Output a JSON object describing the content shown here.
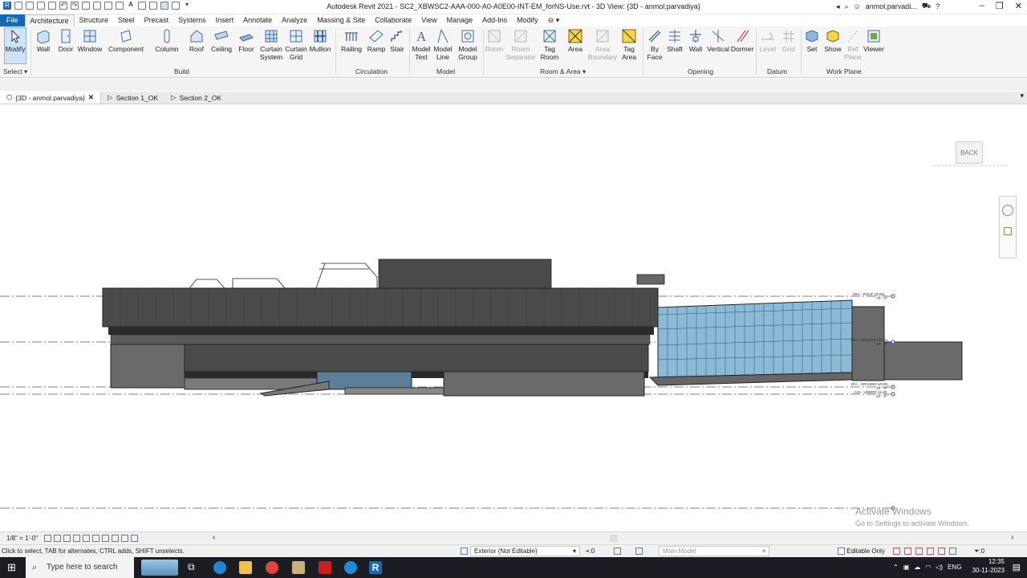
{
  "window": {
    "title": "Autodesk Revit 2021 - SC2_XBWSC2-AAA-000-A0-A0E00-INT-EM_forNS-Use.rvt - 3D View: {3D - anmol.parvadiya}",
    "user": "anmol.parvadi..."
  },
  "ribbon_tabs": [
    "File",
    "Architecture",
    "Structure",
    "Steel",
    "Precast",
    "Systems",
    "Insert",
    "Annotate",
    "Analyze",
    "Massing & Site",
    "Collaborate",
    "View",
    "Manage",
    "Add-Ins",
    "Modify"
  ],
  "ribbon": {
    "modify": "Modify",
    "select": "Select",
    "build": {
      "label": "Build",
      "wall": "Wall",
      "door": "Door",
      "window": "Window",
      "component": "Component",
      "column": "Column",
      "roof": "Roof",
      "ceiling": "Ceiling",
      "floor": "Floor",
      "curtain_system_1": "Curtain",
      "curtain_system_2": "System",
      "curtain_grid_1": "Curtain",
      "curtain_grid_2": "Grid",
      "mullion": "Mullion"
    },
    "circulation": {
      "label": "Circulation",
      "railing": "Railing",
      "ramp": "Ramp",
      "stair": "Stair"
    },
    "model": {
      "label": "Model",
      "model_text_1": "Model",
      "model_text_2": "Text",
      "model_line_1": "Model",
      "model_line_2": "Line",
      "model_group_1": "Model",
      "model_group_2": "Group"
    },
    "room_area": {
      "label": "Room & Area",
      "room": "Room",
      "room_sep_1": "Room",
      "room_sep_2": "Separator",
      "tag_room_1": "Tag",
      "tag_room_2": "Room",
      "area": "Area",
      "area_boundary_1": "Area",
      "area_boundary_2": "Boundary",
      "tag_area_1": "Tag",
      "tag_area_2": "Area"
    },
    "opening": {
      "label": "Opening",
      "by_face_1": "By",
      "by_face_2": "Face",
      "shaft": "Shaft",
      "wall": "Wall",
      "vertical": "Vertical",
      "dormer": "Dormer"
    },
    "datum": {
      "label": "Datum",
      "level": "Level",
      "grid": "Grid"
    },
    "work_plane": {
      "label": "Work Plane",
      "set": "Set",
      "show": "Show",
      "ref_plane_1": "Ref",
      "ref_plane_2": "Plane",
      "viewer": "Viewer"
    }
  },
  "view_tabs": [
    {
      "label": "{3D - anmol.parvadiya}"
    },
    {
      "label": "Section 1_OK"
    },
    {
      "label": "Section 2_OK"
    }
  ],
  "levels": [
    {
      "name": "3RA - ROOF LEVEL",
      "elev": "70' - 0\""
    },
    {
      "name": "2RA - SECOND LEVEL",
      "elev": "60' - 0\""
    },
    {
      "name": "1RA - GROUND LEVEL",
      "elev": "45' - 0\""
    },
    {
      "name": "1UA - UNDER SLAB",
      "elev": "42' - 6\""
    }
  ],
  "viewcube": {
    "label": "BACK"
  },
  "view_control": {
    "scale": "1/8\" = 1'-0\""
  },
  "status": {
    "hint": "Click to select, TAB for alternates, CTRL adds, SHIFT unselects.",
    "workset": "Exterior (Not Editable)",
    "selection_count": ":0",
    "design_option": "Main Model",
    "editable_only": "Editable Only",
    "filter_count": ":0"
  },
  "watermark": {
    "title": "Activate Windows",
    "subtitle": "Go to Settings to activate Windows."
  },
  "taskbar": {
    "search_placeholder": "Type here to search",
    "language": "ENG",
    "time": "12:35",
    "date": "30-11-2023"
  }
}
